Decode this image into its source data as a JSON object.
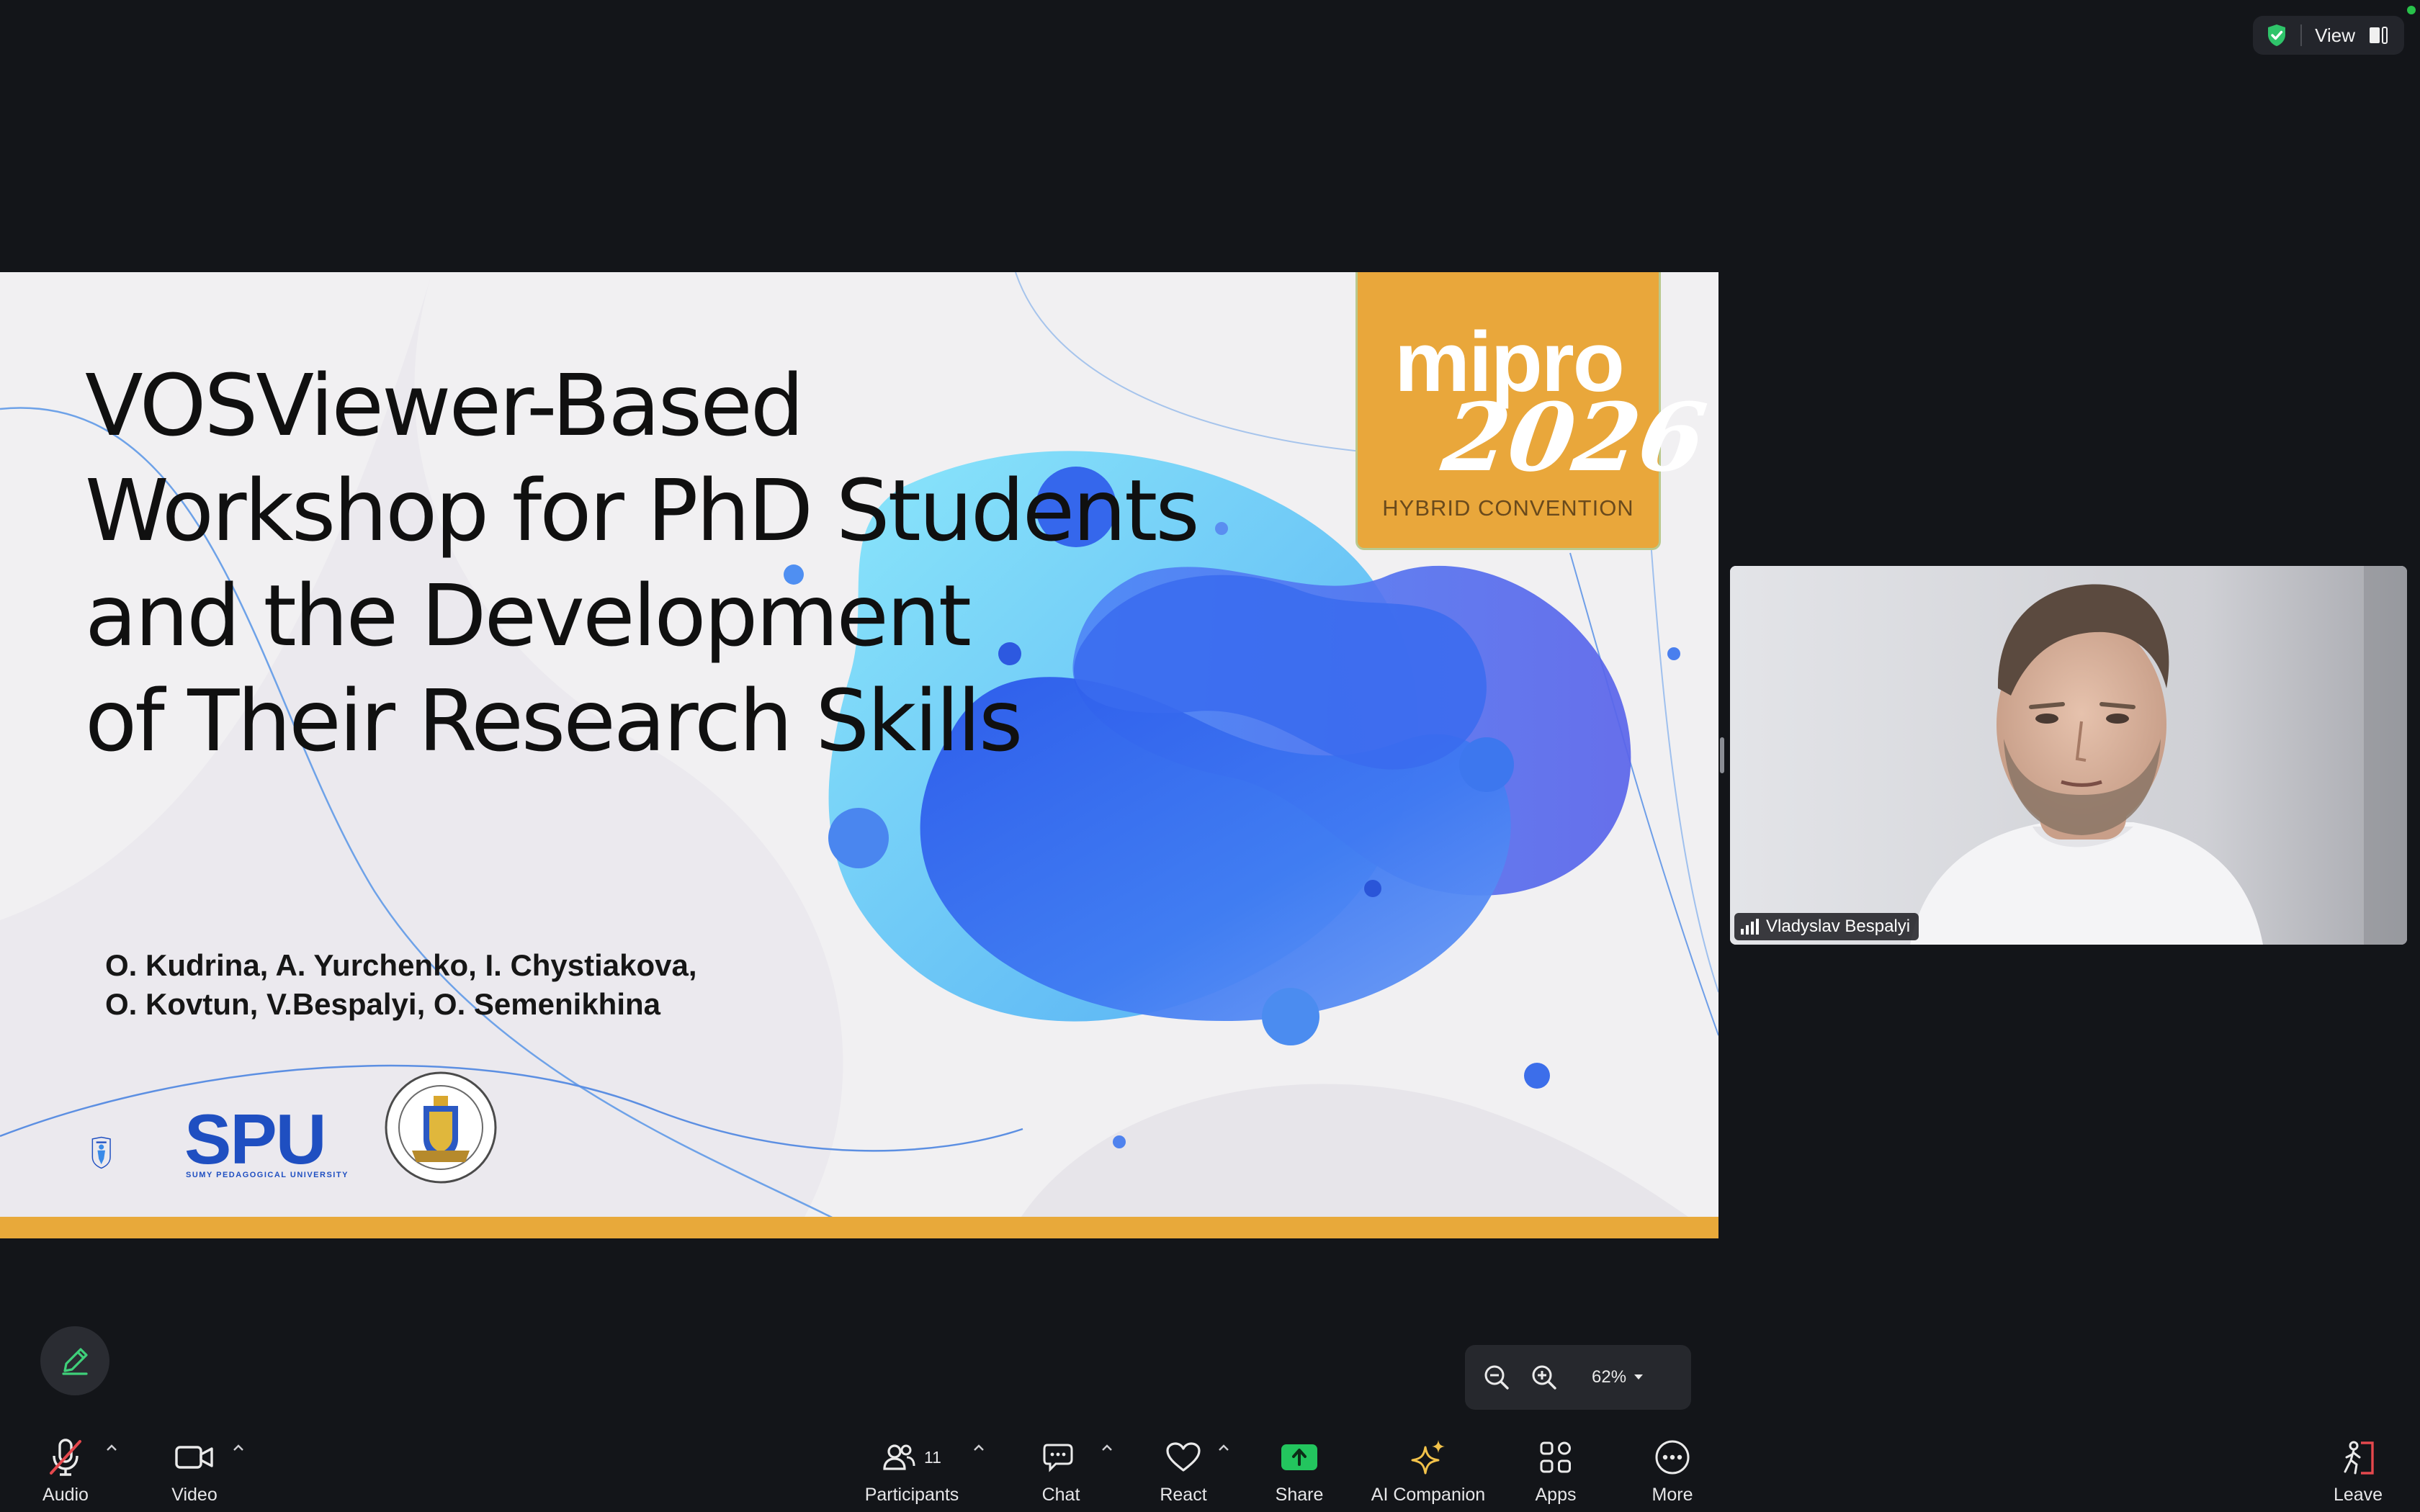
{
  "top_bar": {
    "view_label": "View"
  },
  "slide": {
    "title_lines": [
      "VOSViewer-Based",
      "Workshop for PhD Students",
      "and the Development",
      "of Their Research Skills"
    ],
    "authors_lines": [
      "O. Kudrina, A. Yurchenko, I. Chystiakova,",
      "O. Kovtun, V.Bespalyi, O. Semenikhina"
    ],
    "conference_logo": {
      "word": "mipro",
      "year": "2026",
      "subtitle": "HYBRID CONVENTION"
    },
    "university_logo": {
      "abbr": "SPU",
      "full_name": "SUMY PEDAGOGICAL UNIVERSITY"
    },
    "colors": {
      "accent_bar": "#e8a93a",
      "logo_bg": "#e9a73b",
      "blob_blue": "#3f6ff0",
      "blob_cyan": "#6fd2f6"
    }
  },
  "participant": {
    "name": "Vladyslav Bespalyi"
  },
  "zoom": {
    "level": "62%"
  },
  "toolbar": {
    "audio": "Audio",
    "video": "Video",
    "participants": "Participants",
    "participants_count": "11",
    "chat": "Chat",
    "react": "React",
    "share": "Share",
    "ai_companion": "AI Companion",
    "apps": "Apps",
    "more": "More",
    "leave": "Leave"
  },
  "colors": {
    "share_green": "#23c55e",
    "leave_red": "#e5484d",
    "ai_gold": "#f2c24a",
    "shield_green": "#2fc46a"
  }
}
